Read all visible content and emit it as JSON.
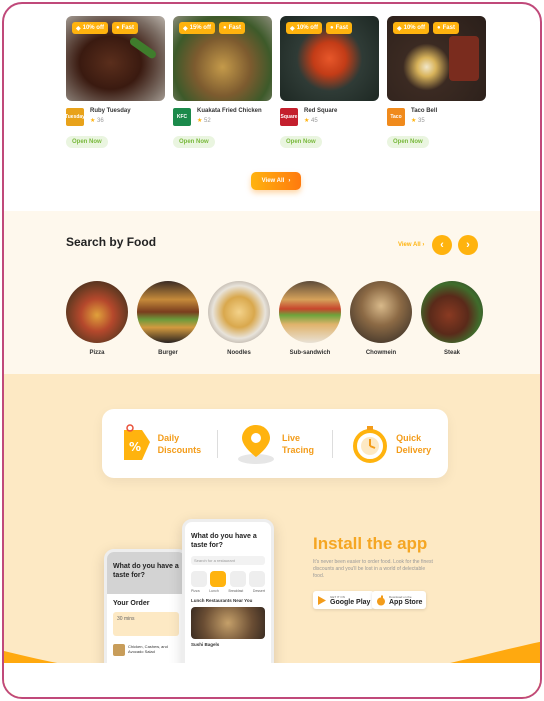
{
  "restaurants": [
    {
      "name": "Ruby Tuesday",
      "rating": "36",
      "discount": "10% off",
      "fast": "Fast",
      "status": "Open Now",
      "logo_text": "Tuesday",
      "logo_color": "#e8a21a"
    },
    {
      "name": "Kuakata Fried Chicken",
      "rating": "52",
      "discount": "15% off",
      "fast": "Fast",
      "status": "Open Now",
      "logo_text": "KFC",
      "logo_color": "#1b8a4b"
    },
    {
      "name": "Red Square",
      "rating": "45",
      "discount": "10% off",
      "fast": "Fast",
      "status": "Open Now",
      "logo_text": "Square",
      "logo_color": "#c41f2d"
    },
    {
      "name": "Taco Bell",
      "rating": "35",
      "discount": "10% off",
      "fast": "Fast",
      "status": "Open Now",
      "logo_text": "Taco",
      "logo_color": "#f08a1c"
    }
  ],
  "view_all_button": "View All",
  "search_by_food": {
    "title": "Search by Food",
    "view_all": "View All",
    "foods": [
      "Pizza",
      "Burger",
      "Noodles",
      "Sub-sandwich",
      "Chowmein",
      "Steak"
    ]
  },
  "features": [
    {
      "line1": "Daily",
      "line2": "Discounts"
    },
    {
      "line1": "Live",
      "line2": "Tracing"
    },
    {
      "line1": "Quick",
      "line2": "Delivery"
    }
  ],
  "install": {
    "title": "Install the app",
    "text": "It's never been easier to order food. Look for the finest discounts and you'll be lost in a world of delectable food.",
    "google_small": "GET IT ON",
    "google_big": "Google Play",
    "apple_small": "Download on the",
    "apple_big": "App Store"
  },
  "phone_b": {
    "heading": "What do you have a taste for?",
    "search": "Search for a restaurant",
    "cats": [
      "Pizza",
      "Lunch",
      "Breakfast",
      "Dessert"
    ],
    "section": "Lunch Restaurants Near You",
    "shop": "Sushi Bagels"
  },
  "phone_a": {
    "heading": "What do you have a taste for?",
    "order_title": "Your Order",
    "eta": "30 mins",
    "item": "Chicken, Cashew, and Avocado Salad"
  },
  "colors": {
    "accent": "#ffb30e",
    "orange": "#f5a623",
    "green": "#79b93c"
  }
}
